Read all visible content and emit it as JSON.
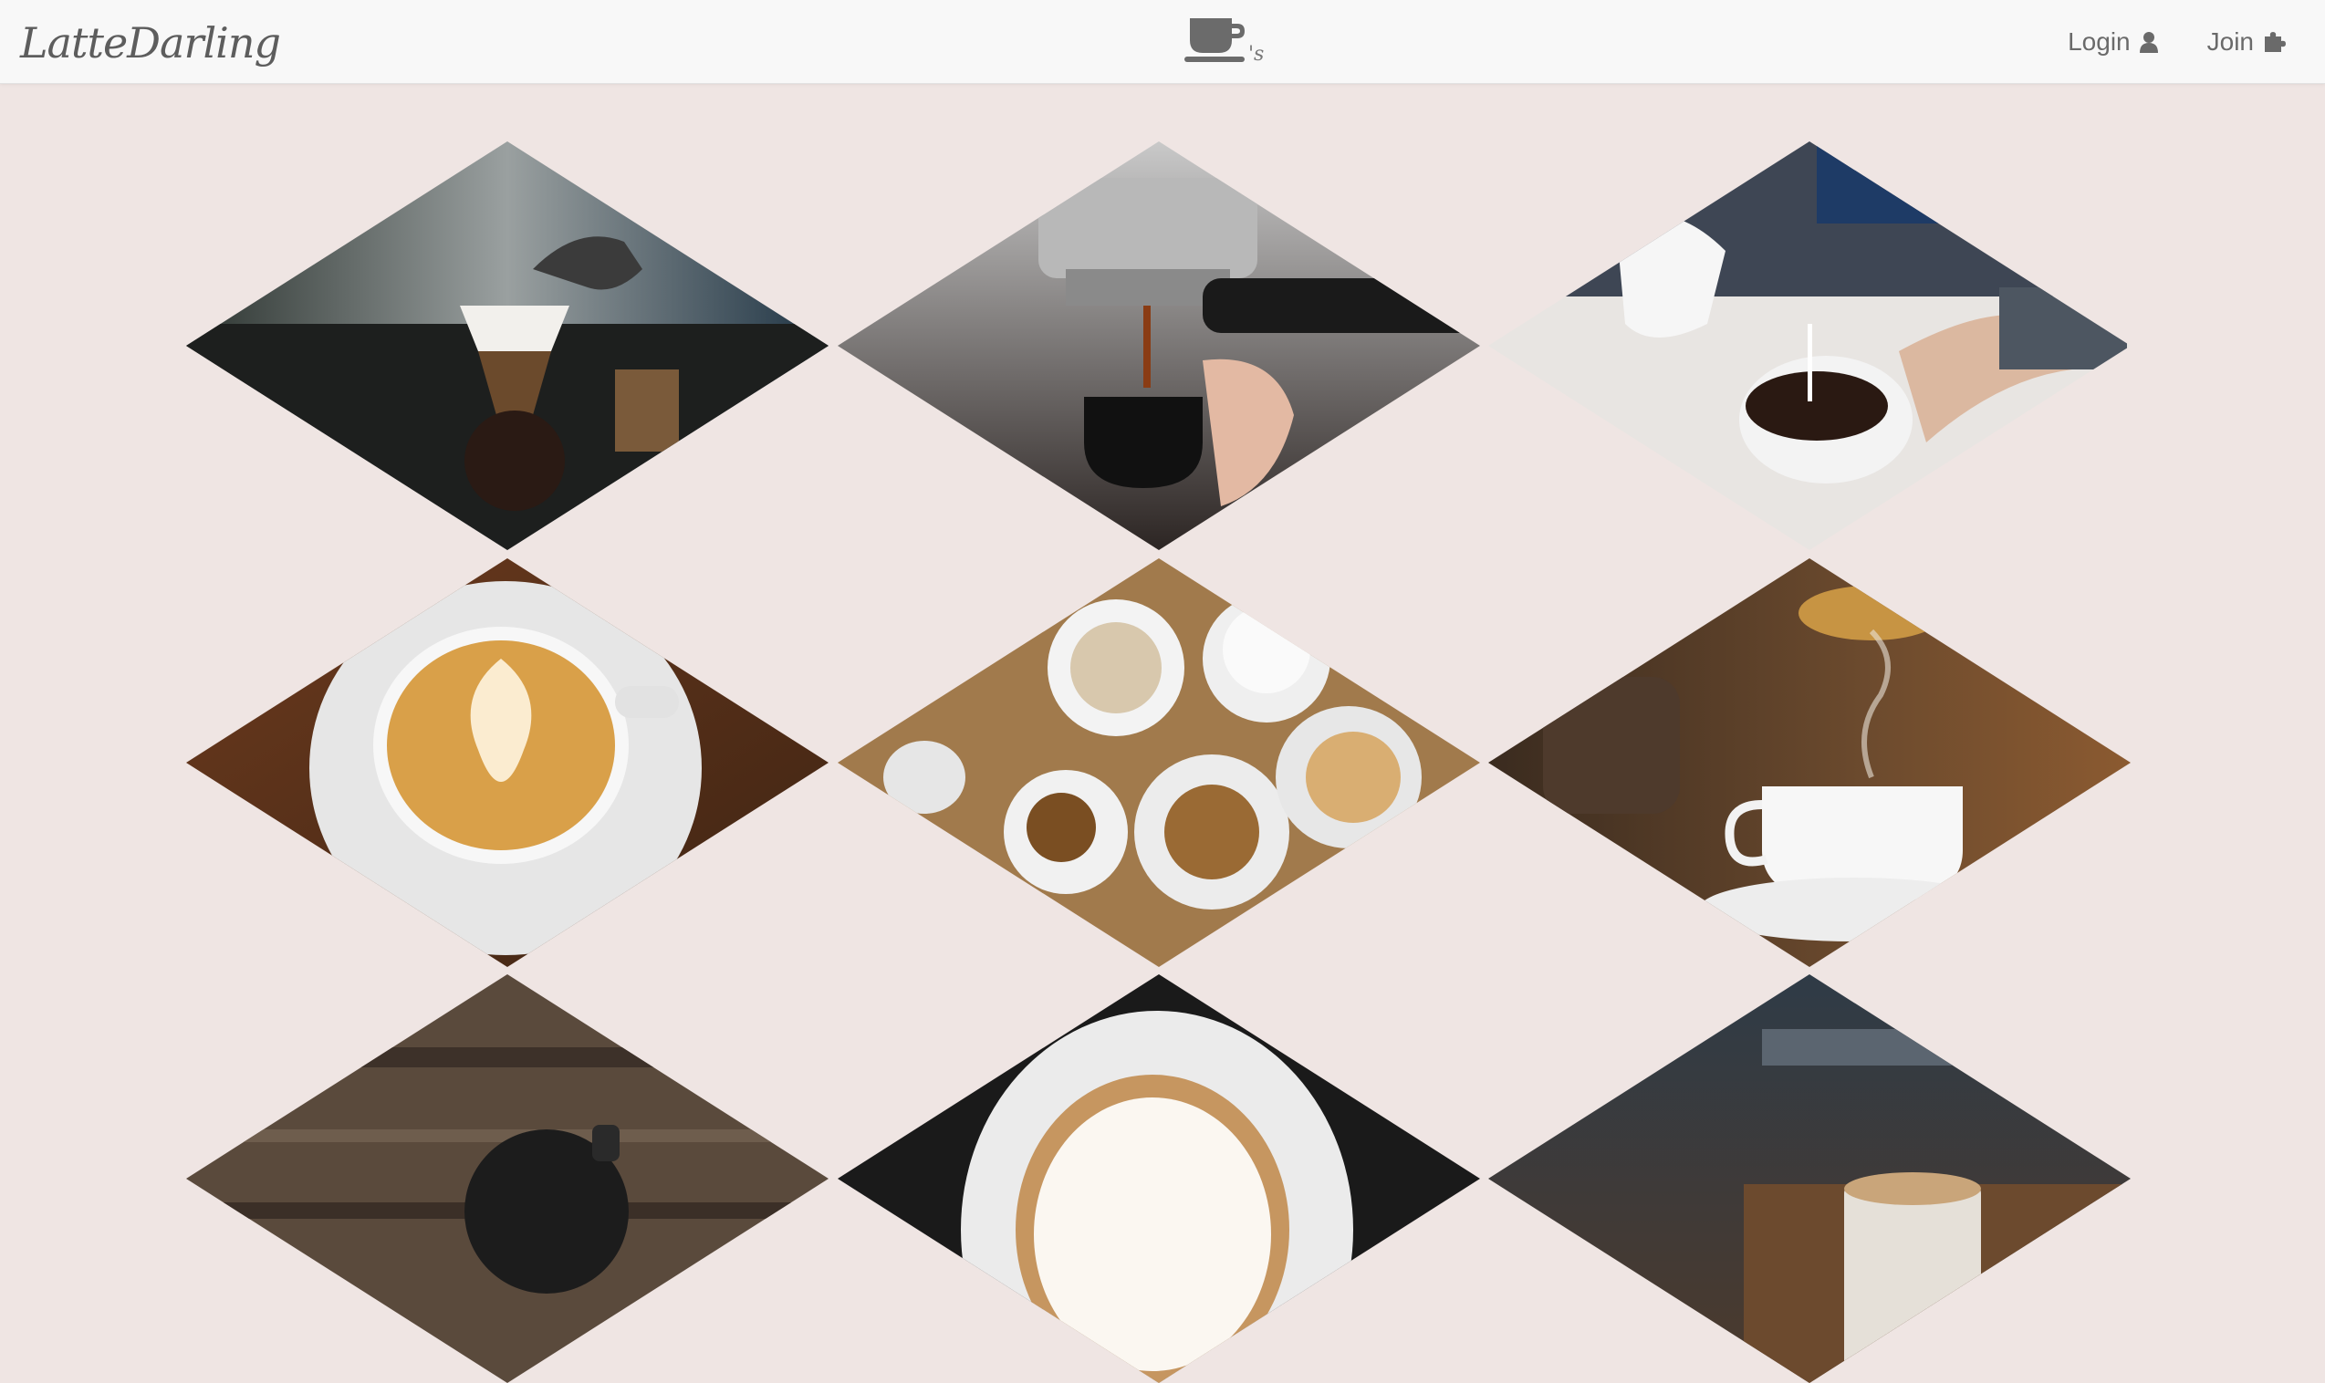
{
  "brand": {
    "name": "LatteDarling"
  },
  "nav": {
    "login_label": "Login",
    "join_label": "Join"
  },
  "icons": {
    "center_logo": "coffee-cup-logo",
    "login": "user-icon",
    "join": "puzzle-piece-icon"
  },
  "colors": {
    "background": "#efe5e3",
    "navbar": "#f8f8f8",
    "text": "#6a6a6a"
  },
  "gallery": [
    {
      "id": "pour-over",
      "subject": "pour-over coffee brewing"
    },
    {
      "id": "espresso-machine",
      "subject": "espresso extraction"
    },
    {
      "id": "milk-pour",
      "subject": "pouring milk into coffee"
    },
    {
      "id": "latte-art",
      "subject": "latte art cup"
    },
    {
      "id": "cups-table",
      "subject": "assorted coffee cups on table"
    },
    {
      "id": "cafe-cup",
      "subject": "cup in cafe interior"
    },
    {
      "id": "wood-mug",
      "subject": "mug on wooden table"
    },
    {
      "id": "cappuccino",
      "subject": "cappuccino foam"
    },
    {
      "id": "cafe-glass",
      "subject": "coffee glass in cafe"
    }
  ]
}
